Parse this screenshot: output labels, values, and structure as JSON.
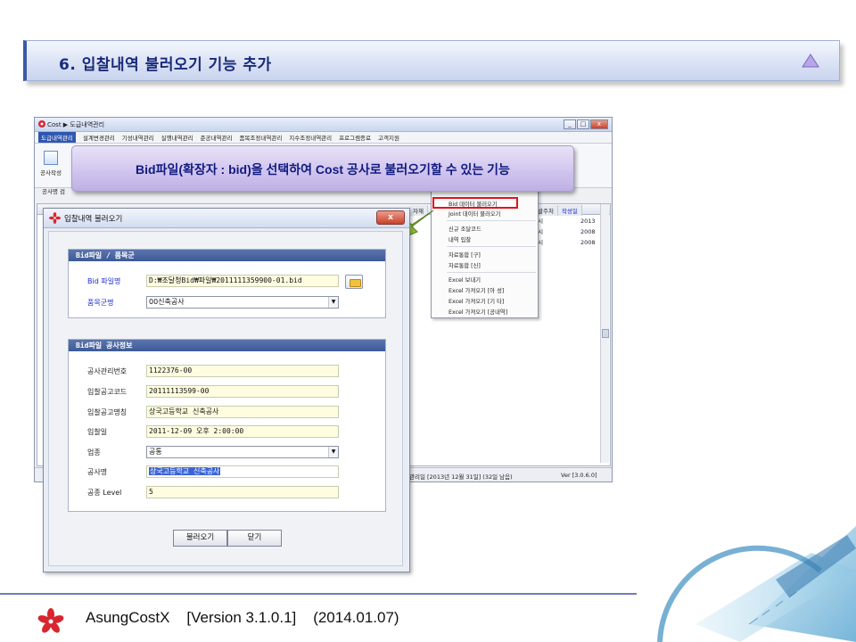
{
  "slide": {
    "title": "6. 입찰내역 불러오기 기능 추가",
    "footer": {
      "product": "AsungCostX",
      "version": "[Version 3.1.0.1]",
      "date": "(2014.01.07)"
    },
    "callout": "Bid파일(확장자 : bid)을 선택하여 Cost 공사로 불러오기할 수 있는 기능"
  },
  "app_window": {
    "title": "Cost ▶ 도급내역관리",
    "menu": [
      "도급내역관리",
      "설계변경관리",
      "기성내역관리",
      "실행내역관리",
      "준공내역관리",
      "품목조정내역관리",
      "지수조정내역관리",
      "프로그램종료",
      "고객지원"
    ],
    "toolbar_label": "공사작성",
    "search_label": "공사명 검",
    "grid_headers": [
      "자재",
      "발주처",
      "작성일"
    ],
    "grid_rows": [
      {
        "col1": "0시",
        "col2": "2013"
      },
      {
        "col1": "0시",
        "col2": "2008"
      },
      {
        "col1": "0시",
        "col2": "2008"
      }
    ],
    "status_left": "관리일  [2013년 12월 31일]  (32일 남음)",
    "status_right": "Ver [3.0.6.0]"
  },
  "context_menu": {
    "items": [
      "Bid  데이터 불러오기",
      "Joint 데이터 불러오기",
      "신규 조달코드",
      "내역 입찰",
      "자료통합 [구]",
      "자료통합 [신]",
      "Excel 보내기",
      "Excel 가져오기 [아    성]",
      "Excel 가져오기 [기    타]",
      "Excel 가져오기 [공내역]"
    ],
    "highlighted_index": 0,
    "highlight_color": "#e0151b"
  },
  "dialog": {
    "title": "입찰내역 불러오기",
    "close_label": "x",
    "group1": {
      "header": "Bid파일 / 품목군",
      "bid_file_label": "Bid 파일명",
      "bid_file_value": "D:₩조달청Bid₩파일₩2011111359900-01.bid",
      "category_label": "품목군명",
      "category_value": "00신축공사"
    },
    "group2": {
      "header": "Bid파일 공사정보",
      "fields": [
        {
          "label": "공사관리번호",
          "value": "1122376-00",
          "kind": "input"
        },
        {
          "label": "입찰공고코드",
          "value": "20111113599-00",
          "kind": "input"
        },
        {
          "label": "입찰공고명칭",
          "value": "상국고등학교 신축공사",
          "kind": "input"
        },
        {
          "label": "입찰일",
          "value": "2011-12-09 오후 2:00:00",
          "kind": "input"
        },
        {
          "label": "업종",
          "value": "공통",
          "kind": "select"
        },
        {
          "label": "공사명",
          "value": "상국고등학교 신축공사",
          "kind": "selected"
        },
        {
          "label": "공종 Level",
          "value": "5",
          "kind": "input"
        }
      ]
    },
    "buttons": {
      "load": "불러오기",
      "close": "닫기"
    }
  },
  "colors": {
    "title_text": "#1a2a7a",
    "group_header": "#3d5a98",
    "callout_text": "#101a80",
    "input_bg": "#fffde0"
  }
}
